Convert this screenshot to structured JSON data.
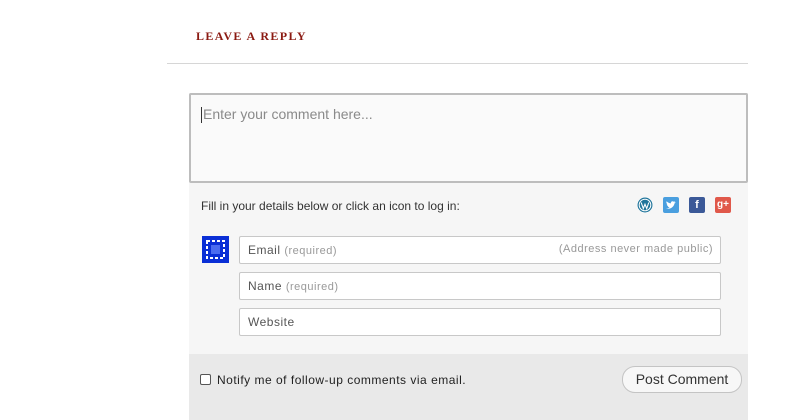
{
  "heading": "LEAVE A REPLY",
  "comment": {
    "placeholder": "Enter your comment here..."
  },
  "instructions": "Fill in your details below or click an icon to log in:",
  "social_icons": [
    "wordpress-icon",
    "twitter-icon",
    "facebook-icon",
    "google-plus-icon"
  ],
  "fields": {
    "email": {
      "label": "Email",
      "required": "(required)",
      "note": "(Address never made public)"
    },
    "name": {
      "label": "Name",
      "required": "(required)"
    },
    "website": {
      "label": "Website"
    }
  },
  "notify_label": "Notify me of follow-up comments via email.",
  "submit_label": "Post Comment",
  "colors": {
    "heading": "#8b1a12",
    "avatar": "#0a2fd6",
    "twitter": "#4a9fdf",
    "facebook": "#3b5998",
    "google_plus": "#e0584a"
  }
}
